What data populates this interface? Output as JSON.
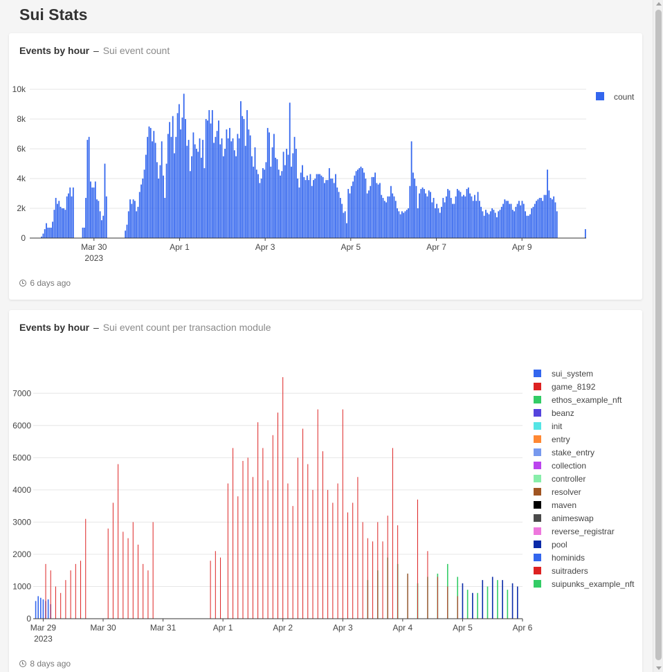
{
  "page": {
    "title": "Sui Stats"
  },
  "cards": [
    {
      "title": "Events by hour",
      "separator": "–",
      "subtitle": "Sui event count",
      "updated": "6 days ago"
    },
    {
      "title": "Events by hour",
      "separator": "–",
      "subtitle": "Sui event count per transaction module",
      "updated": "8 days ago"
    }
  ],
  "chart_data": [
    {
      "type": "bar",
      "title": "",
      "xlabel": "",
      "ylabel": "",
      "ylim": [
        0,
        10000
      ],
      "y_ticks": [
        "0",
        "2k",
        "4k",
        "6k",
        "8k",
        "10k"
      ],
      "x_ticks": [
        "Mar 30",
        "Apr 1",
        "Apr 3",
        "Apr 5",
        "Apr 7",
        "Apr 9"
      ],
      "x_tick_year": "2023",
      "grid": true,
      "legend_position": "top-right",
      "colors": {
        "count": "#3366ee"
      },
      "x_start": "2023-03-28 12:00",
      "x_end": "2023-04-10 12:00",
      "series": [
        {
          "name": "count",
          "values": [
            0,
            0,
            0,
            0,
            0,
            0,
            0,
            100,
            300,
            600,
            1000,
            700,
            700,
            700,
            1100,
            1900,
            2700,
            2300,
            2500,
            2100,
            2000,
            2000,
            1900,
            2800,
            3000,
            3400,
            2800,
            3400,
            0,
            0,
            0,
            0,
            0,
            700,
            700,
            2700,
            6600,
            6800,
            3800,
            3400,
            3400,
            3800,
            2600,
            2500,
            1800,
            1200,
            1500,
            5000,
            2800,
            0,
            0,
            0,
            0,
            0,
            0,
            0,
            0,
            0,
            0,
            0,
            500,
            900,
            1800,
            2600,
            2300,
            2600,
            2500,
            1800,
            2100,
            3100,
            3600,
            4000,
            4600,
            5600,
            6800,
            7500,
            7400,
            6500,
            7200,
            6400,
            5100,
            4000,
            4900,
            6500,
            4200,
            2700,
            5000,
            7000,
            7800,
            6800,
            8200,
            5700,
            6800,
            8400,
            9000,
            7300,
            8100,
            9700,
            8000,
            6200,
            6600,
            4500,
            5500,
            7100,
            6300,
            6000,
            5800,
            6700,
            5400,
            6600,
            4700,
            8000,
            7900,
            8600,
            7700,
            8600,
            6400,
            6800,
            7200,
            7900,
            6300,
            6700,
            5500,
            6000,
            7300,
            6700,
            7400,
            6500,
            6700,
            5900,
            5500,
            7000,
            6700,
            9200,
            8200,
            8000,
            6200,
            8600,
            7300,
            6900,
            5500,
            4800,
            6100,
            4600,
            4300,
            3700,
            4000,
            4700,
            4600,
            5100,
            7400,
            7100,
            4800,
            6100,
            7000,
            5400,
            5300,
            4600,
            4200,
            4500,
            5800,
            4900,
            6000,
            5600,
            9100,
            4800,
            5700,
            6800,
            6000,
            4000,
            3400,
            4400,
            4900,
            4100,
            3900,
            4200,
            3900,
            4300,
            3500,
            3900,
            4000,
            4300,
            4300,
            4300,
            4200,
            4100,
            3700,
            3900,
            3900,
            4700,
            4000,
            4000,
            3700,
            4300,
            3400,
            3100,
            2700,
            2300,
            1700,
            1800,
            1000,
            3300,
            3000,
            3500,
            3800,
            4200,
            4500,
            4600,
            4700,
            4800,
            4700,
            4400,
            4000,
            3000,
            3200,
            3500,
            4100,
            4100,
            4400,
            3700,
            3600,
            3700,
            2900,
            2700,
            2500,
            2400,
            2800,
            2800,
            3500,
            3000,
            2800,
            2500,
            2000,
            1800,
            1600,
            1800,
            1700,
            1800,
            1900,
            2000,
            3500,
            6500,
            4400,
            4000,
            3500,
            2000,
            3000,
            3300,
            3400,
            3300,
            3000,
            2800,
            3200,
            3100,
            2400,
            2700,
            2000,
            2300,
            2000,
            1700,
            2100,
            2700,
            2400,
            2800,
            3300,
            3200,
            2700,
            2300,
            2300,
            2800,
            3300,
            3200,
            3100,
            2800,
            2900,
            2800,
            3300,
            3400,
            3000,
            2800,
            2500,
            2900,
            2500,
            3100,
            2500,
            2100,
            1800,
            1500,
            1900,
            1700,
            1600,
            1800,
            2000,
            1900,
            1700,
            1400,
            1800,
            1900,
            2100,
            2300,
            2600,
            2500,
            2500,
            2300,
            2300,
            1900,
            1800,
            2100,
            2300,
            2500,
            2200,
            2500,
            2300,
            1800,
            1500,
            1500,
            1600,
            2000,
            2100,
            2300,
            2500,
            2600,
            2700,
            2700,
            2500,
            2900,
            2900,
            4600,
            3200,
            2700,
            2600,
            2800,
            2400,
            1800,
            0,
            0,
            0,
            0,
            0,
            0,
            0,
            0,
            0,
            0,
            0,
            0,
            0,
            0,
            0,
            0,
            0,
            600
          ]
        }
      ]
    },
    {
      "type": "bar",
      "title": "",
      "xlabel": "",
      "ylabel": "",
      "ylim": [
        0,
        7500
      ],
      "y_ticks": [
        "0",
        "1000",
        "2000",
        "3000",
        "4000",
        "5000",
        "6000",
        "7000"
      ],
      "x_ticks": [
        "Mar 29",
        "Mar 30",
        "Mar 31",
        "Apr 1",
        "Apr 2",
        "Apr 3",
        "Apr 4",
        "Apr 5",
        "Apr 6"
      ],
      "x_tick_year": "2023",
      "grid": true,
      "legend_position": "right",
      "x_start": "2023-03-28 20:00",
      "x_end": "2023-04-06 00:00",
      "legend": [
        {
          "name": "sui_system",
          "color": "#3366ee"
        },
        {
          "name": "game_8192",
          "color": "#dd2222"
        },
        {
          "name": "ethos_example_nft",
          "color": "#33cc66"
        },
        {
          "name": "beanz",
          "color": "#5544dd"
        },
        {
          "name": "init",
          "color": "#55e5e5"
        },
        {
          "name": "entry",
          "color": "#ff8833"
        },
        {
          "name": "stake_entry",
          "color": "#7799ee"
        },
        {
          "name": "collection",
          "color": "#bb44ee"
        },
        {
          "name": "controller",
          "color": "#88eeaa"
        },
        {
          "name": "resolver",
          "color": "#a05522"
        },
        {
          "name": "maven",
          "color": "#000000"
        },
        {
          "name": "animeswap",
          "color": "#4a4a4a"
        },
        {
          "name": "reverse_registrar",
          "color": "#ee77dd"
        },
        {
          "name": "pool",
          "color": "#0a2aa8"
        },
        {
          "name": "hominids",
          "color": "#3366ee"
        },
        {
          "name": "suitraders",
          "color": "#dd2222"
        },
        {
          "name": "suipunks_example_nft",
          "color": "#33cc66"
        }
      ],
      "series": [
        {
          "name": "game_8192",
          "x": [
            "03-29 01:00",
            "03-29 03:00",
            "03-29 05:00",
            "03-29 07:00",
            "03-29 09:00",
            "03-29 11:00",
            "03-29 13:00",
            "03-29 15:00",
            "03-29 17:00",
            "03-30 02:00",
            "03-30 04:00",
            "03-30 06:00",
            "03-30 08:00",
            "03-30 10:00",
            "03-30 12:00",
            "03-30 14:00",
            "03-30 16:00",
            "03-30 18:00",
            "03-30 20:00",
            "03-31 19:00",
            "03-31 21:00",
            "03-31 23:00",
            "04-01 02:00",
            "04-01 04:00",
            "04-01 06:00",
            "04-01 08:00",
            "04-01 10:00",
            "04-01 12:00",
            "04-01 14:00",
            "04-01 16:00",
            "04-01 18:00",
            "04-01 20:00",
            "04-01 22:00",
            "04-02 00:00",
            "04-02 02:00",
            "04-02 04:00",
            "04-02 06:00",
            "04-02 08:00",
            "04-02 10:00",
            "04-02 12:00",
            "04-02 14:00",
            "04-02 16:00",
            "04-02 18:00",
            "04-02 20:00",
            "04-02 22:00",
            "04-03 00:00",
            "04-03 02:00",
            "04-03 04:00",
            "04-03 06:00",
            "04-03 08:00",
            "04-03 10:00",
            "04-03 12:00",
            "04-03 14:00",
            "04-03 16:00",
            "04-03 18:00",
            "04-03 20:00",
            "04-03 22:00",
            "04-04 02:00",
            "04-04 06:00",
            "04-04 10:00",
            "04-04 14:00",
            "04-04 18:00",
            "04-04 22:00"
          ],
          "values": [
            1700,
            1500,
            1000,
            800,
            1200,
            1500,
            1700,
            1800,
            3100,
            2800,
            3600,
            4800,
            2700,
            2500,
            3000,
            2300,
            1700,
            1500,
            3000,
            1800,
            2100,
            1900,
            4200,
            5300,
            3800,
            4900,
            5000,
            4400,
            6100,
            5300,
            4300,
            5700,
            6400,
            7500,
            4200,
            3500,
            5000,
            5900,
            4800,
            4000,
            6500,
            5200,
            4000,
            3600,
            4200,
            6500,
            3300,
            3600,
            4400,
            3000,
            2500,
            2400,
            3000,
            2400,
            3200,
            5300,
            2900,
            1400,
            3700,
            2100,
            1300,
            1000,
            700
          ]
        },
        {
          "name": "sui_system",
          "x": [
            "03-28 21:00",
            "03-28 22:00",
            "03-28 23:00",
            "03-29 00:00",
            "03-29 01:00",
            "03-29 02:00",
            "03-29 03:00"
          ],
          "values": [
            550,
            700,
            650,
            600,
            550,
            600,
            450
          ]
        },
        {
          "name": "ethos_example_nft",
          "x": [
            "04-03 10:00",
            "04-03 14:00",
            "04-03 18:00",
            "04-03 22:00",
            "04-04 02:00",
            "04-04 06:00",
            "04-04 10:00",
            "04-04 14:00",
            "04-04 18:00",
            "04-04 22:00",
            "04-05 02:00",
            "04-05 06:00",
            "04-05 10:00",
            "04-05 14:00",
            "04-05 18:00"
          ],
          "values": [
            1200,
            1500,
            1900,
            1700,
            1400,
            1100,
            1300,
            1400,
            1700,
            1300,
            900,
            800,
            1000,
            1200,
            900
          ]
        },
        {
          "name": "pool",
          "x": [
            "04-05 00:00",
            "04-05 04:00",
            "04-05 08:00",
            "04-05 12:00",
            "04-05 16:00",
            "04-05 20:00",
            "04-05 22:00"
          ],
          "values": [
            1100,
            800,
            1200,
            1300,
            1200,
            1100,
            1000
          ]
        }
      ]
    }
  ]
}
